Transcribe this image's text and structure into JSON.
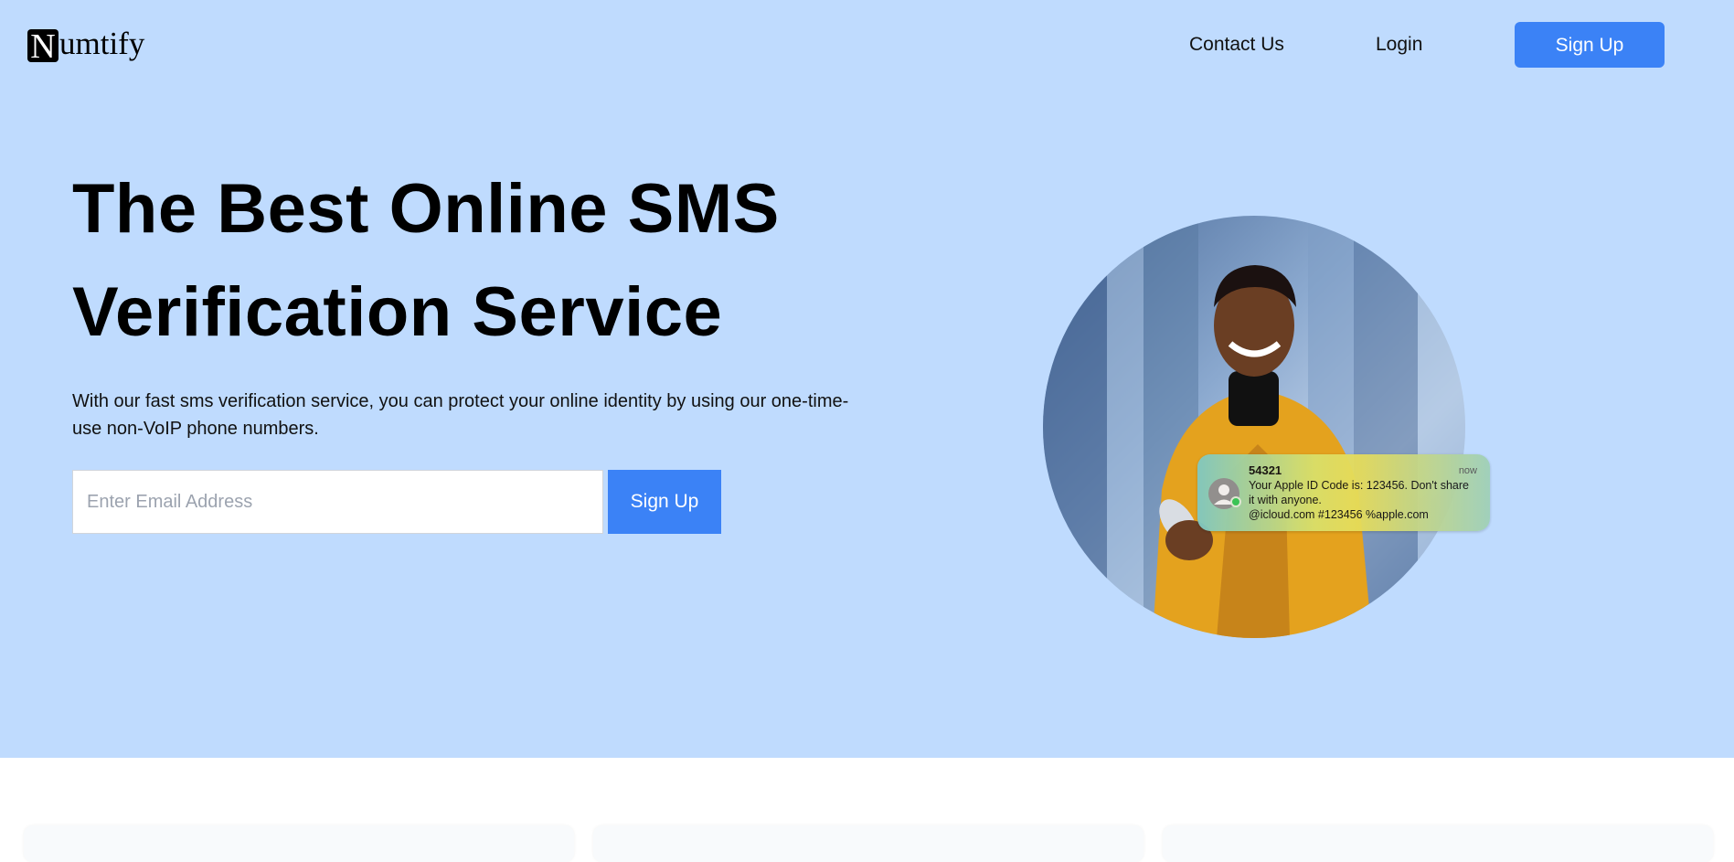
{
  "brand": {
    "logo_initial": "N",
    "logo_rest": "umtify"
  },
  "nav": {
    "contact_label": "Contact Us",
    "login_label": "Login",
    "signup_label": "Sign Up"
  },
  "hero": {
    "headline_line1": "The Best Online SMS",
    "headline_line2": "Verification Service",
    "subtext": "With our fast sms verification service, you can protect your online identity by using our one-time-use non-VoIP phone numbers.",
    "email_placeholder": "Enter Email Address",
    "email_value": "",
    "signup_label": "Sign Up"
  },
  "notification": {
    "sender": "54321",
    "time": "now",
    "line1": "Your Apple ID Code is: 123456. Don't share it with anyone.",
    "line2": "@icloud.com #123456 %apple.com"
  },
  "colors": {
    "hero_bg": "#bfdbfe",
    "accent": "#3b82f6"
  },
  "icons": {
    "notification_avatar": "person-icon",
    "online_status": "online-dot-icon"
  }
}
